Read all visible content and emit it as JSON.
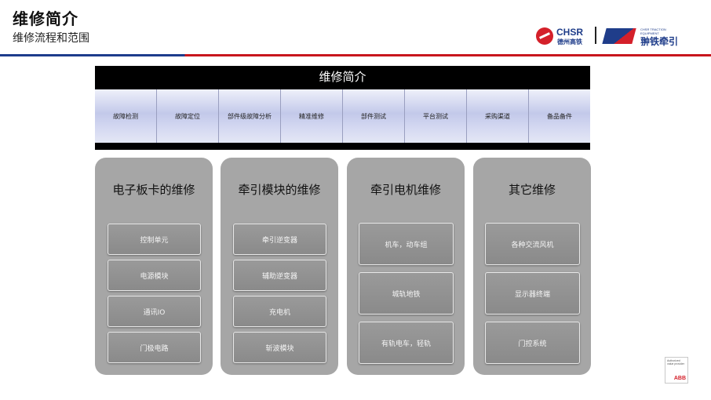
{
  "header": {
    "title": "维修简介",
    "subtitle": "维修流程和范围"
  },
  "logos": {
    "chsr_en": "CHSR",
    "chsr_cn": "德州高铁",
    "cte_small": "CHSR TRACTION EQUIPMENT",
    "cte_cn": "翀铁牵引",
    "abb_badge": "Authorized value provider",
    "abb": "ABB"
  },
  "banner": {
    "title": "维修简介",
    "steps": [
      "故障检测",
      "故障定位",
      "部件级故障分析",
      "精准维修",
      "部件测试",
      "平台测试",
      "采购渠道",
      "备品备件"
    ]
  },
  "panels": [
    {
      "title": "电子板卡的维修",
      "items": [
        "控制单元",
        "电源模块",
        "通讯IO",
        "门极电路"
      ]
    },
    {
      "title": "牵引模块的维修",
      "items": [
        "牵引逆变器",
        "辅助逆变器",
        "充电机",
        "斩波模块"
      ]
    },
    {
      "title": "牵引电机维修",
      "items": [
        "机车，动车组",
        "城轨地铁",
        "有轨电车，轻轨"
      ]
    },
    {
      "title": "其它维修",
      "items": [
        "各种交流风机",
        "显示器终端",
        "门控系统"
      ]
    }
  ],
  "colors": {
    "banner_bg": "#000000",
    "panel_bg": "#a6a6a6",
    "rule_blue": "#1e3c8c",
    "rule_red": "#c8161d"
  }
}
